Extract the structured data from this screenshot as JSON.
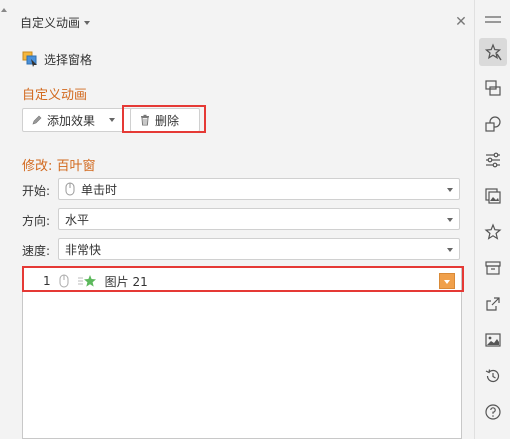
{
  "panel": {
    "title": "自定义动画",
    "select_pane_label": "选择窗格",
    "section_title": "自定义动画",
    "add_effect_label": "添加效果",
    "delete_label": "删除",
    "modify_title": "修改: 百叶窗"
  },
  "fields": {
    "start": {
      "label": "开始:",
      "value": "单击时"
    },
    "direction": {
      "label": "方向:",
      "value": "水平"
    },
    "speed": {
      "label": "速度:",
      "value": "非常快"
    }
  },
  "list": {
    "items": [
      {
        "index": "1",
        "name": "图片 21"
      }
    ]
  },
  "sidebar": {
    "icons": [
      "custom-animation-icon",
      "slide-transition-icon",
      "shapes-icon",
      "properties-icon",
      "gallery-icon",
      "star-icon",
      "archive-icon",
      "share-icon",
      "image-icon",
      "history-icon",
      "help-icon"
    ]
  },
  "colors": {
    "accent": "#d2691e",
    "highlight": "#e53935",
    "list_dropdown": "#f0a04b"
  }
}
